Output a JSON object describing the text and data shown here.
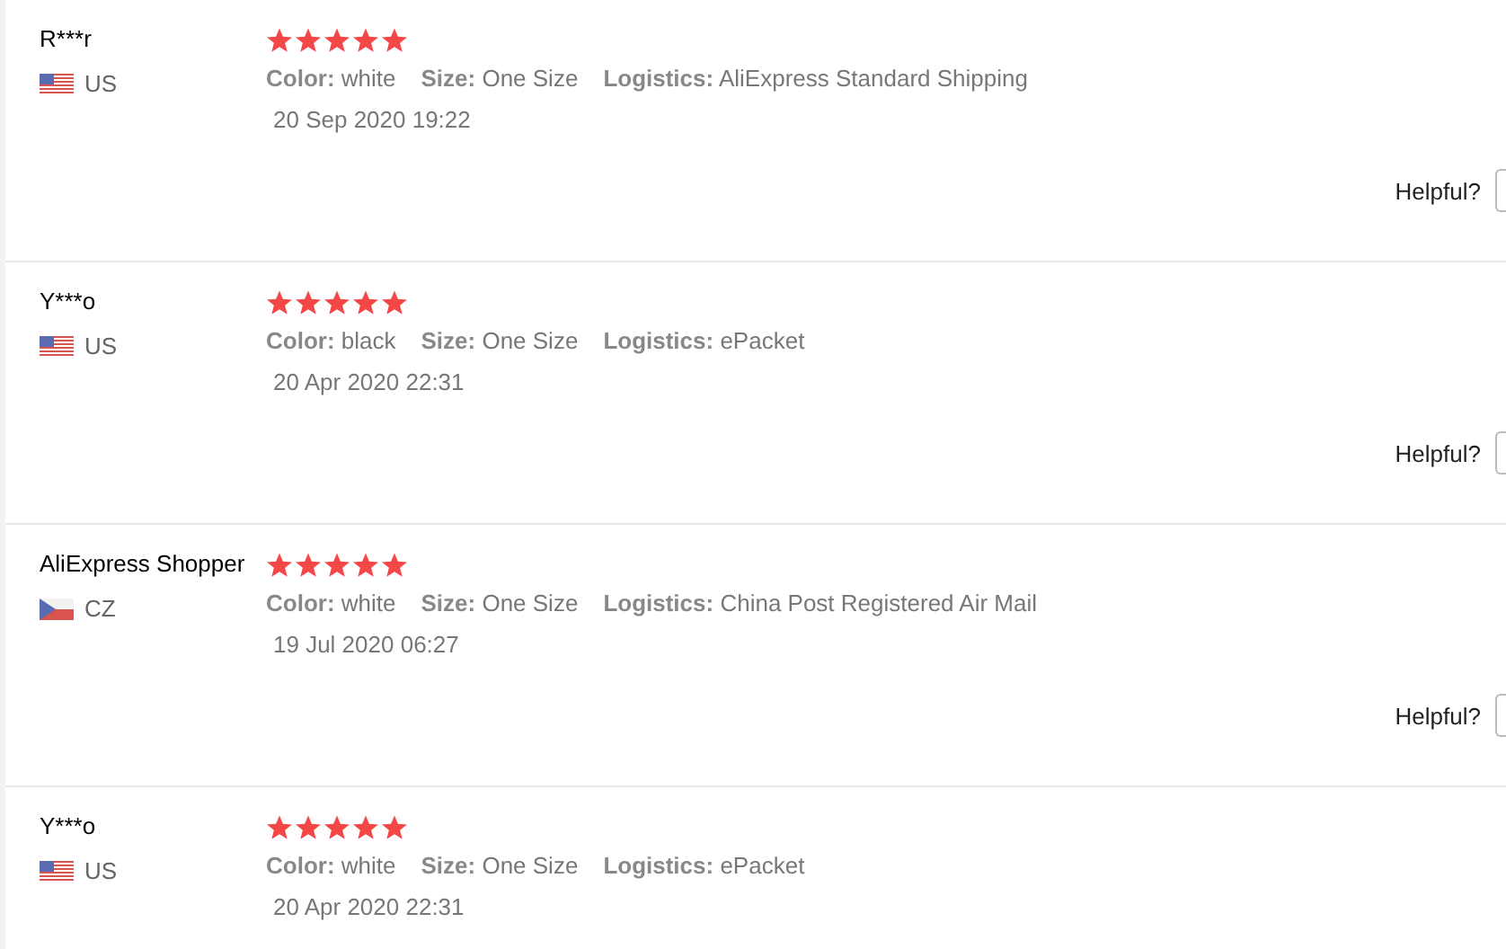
{
  "reviews": [
    {
      "name": "R***r",
      "kind": "us",
      "country": "US",
      "stars": 5,
      "attributes": [
        {
          "label": "Color:",
          "value": "white"
        },
        {
          "label": "Size:",
          "value": "One Size"
        },
        {
          "label": "Logistics:",
          "value": "AliExpress Standard Shipping"
        }
      ],
      "date": "20 Sep 2020 19:22",
      "helpful_label": "Helpful?"
    },
    {
      "name": "Y***o",
      "kind": "us",
      "country": "US",
      "stars": 5,
      "attributes": [
        {
          "label": "Color:",
          "value": "black"
        },
        {
          "label": "Size:",
          "value": "One Size"
        },
        {
          "label": "Logistics:",
          "value": "ePacket"
        }
      ],
      "date": "20 Apr 2020 22:31",
      "helpful_label": "Helpful?"
    },
    {
      "name": "AliExpress Shopper",
      "kind": "cz",
      "country": "CZ",
      "stars": 5,
      "attributes": [
        {
          "label": "Color:",
          "value": "white"
        },
        {
          "label": "Size:",
          "value": "One Size"
        },
        {
          "label": "Logistics:",
          "value": "China Post Registered Air Mail"
        }
      ],
      "date": "19 Jul 2020 06:27",
      "helpful_label": "Helpful?"
    },
    {
      "name": "Y***o",
      "kind": "us",
      "country": "US",
      "stars": 5,
      "attributes": [
        {
          "label": "Color:",
          "value": "white"
        },
        {
          "label": "Size:",
          "value": "One Size"
        },
        {
          "label": "Logistics:",
          "value": "ePacket"
        }
      ],
      "date": "20 Apr 2020 22:31"
    }
  ]
}
